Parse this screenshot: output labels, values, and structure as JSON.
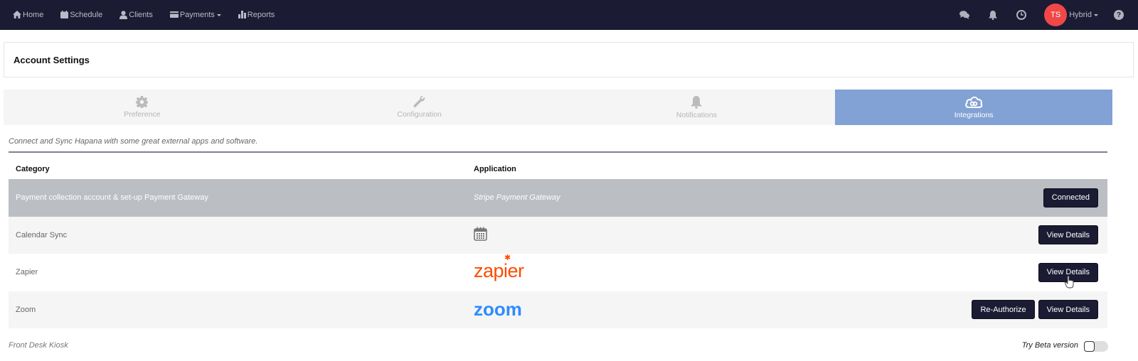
{
  "nav": {
    "items": [
      {
        "label": "Home",
        "icon": "home-icon"
      },
      {
        "label": "Schedule",
        "icon": "calendar-icon"
      },
      {
        "label": "Clients",
        "icon": "user-icon"
      },
      {
        "label": "Payments",
        "icon": "credit-card-icon",
        "dropdown": true
      },
      {
        "label": "Reports",
        "icon": "bar-chart-icon"
      }
    ],
    "right_icons": [
      "chat-icon",
      "bell-icon",
      "clock-icon"
    ],
    "avatar_initials": "TS",
    "avatar_color": "#f04747",
    "user_label": "Hybrid",
    "help": "?"
  },
  "page": {
    "title": "Account Settings"
  },
  "tabs": [
    {
      "label": "Preference",
      "icon": "gear-icon",
      "active": false
    },
    {
      "label": "Configuration",
      "icon": "wrench-icon",
      "active": false
    },
    {
      "label": "Notifications",
      "icon": "bell-icon",
      "active": false
    },
    {
      "label": "Integrations",
      "icon": "cloud-link-icon",
      "active": true
    }
  ],
  "intro": "Connect and Sync Hapana with some great external apps and software.",
  "table": {
    "headers": {
      "category": "Category",
      "application": "Application"
    },
    "rows": [
      {
        "category": "Payment collection account & set-up Payment Gateway",
        "application": "Stripe Payment Gateway",
        "buttons": [
          "Connected"
        ]
      },
      {
        "category": "Calendar Sync",
        "application_icon": "calendar-icon",
        "buttons": [
          "View Details"
        ]
      },
      {
        "category": "Zapier",
        "application_logo": "zapier",
        "buttons": [
          "View Details"
        ]
      },
      {
        "category": "Zoom",
        "application_logo": "zoom",
        "buttons": [
          "Re-Authorize",
          "View Details"
        ]
      }
    ]
  },
  "logos": {
    "zapier": "zapier",
    "zoom": "zoom"
  },
  "footer": {
    "section_label": "Front Desk Kiosk",
    "beta_label": "Try Beta version",
    "beta_enabled": false
  },
  "colors": {
    "topbar": "#1b1b33",
    "active_tab": "#82a1d4",
    "button": "#1b1b33",
    "zapier": "#ff4a00",
    "zoom": "#2d8cff"
  }
}
